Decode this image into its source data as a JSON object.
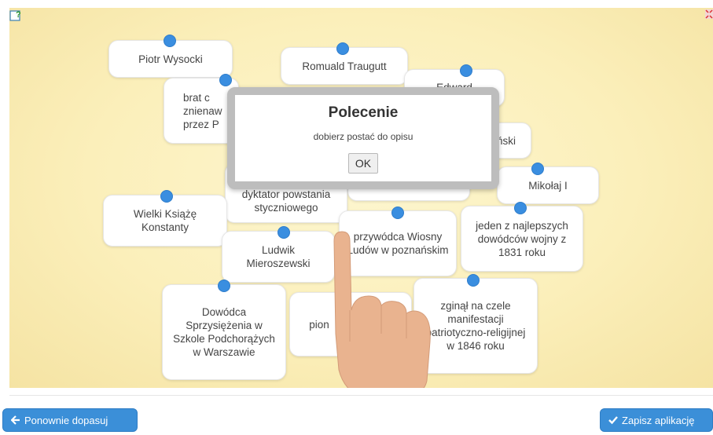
{
  "toolbar": {
    "help_icon": "help-question-icon",
    "fullscreen_icon": "fullscreen-icon"
  },
  "cards": {
    "piotr_wysocki": "Piotr Wysocki",
    "romuald_traugutt": "Romuald Traugutt",
    "edward": "Edward",
    "brat_partial": "brat c znienaw przez P",
    "ski_partial": "ński",
    "mikolaj": "Mikołaj I",
    "dyktator": "dyktator powstania styczniowego",
    "wielki_ksiaze": "Wielki Książę Konstanty",
    "wiosna_ludow": "przywódca Wiosny Ludów w poznańskim",
    "jeden_z": "jeden z najlepszych dowódców wojny z 1831 roku",
    "ludwik": "Ludwik Mieroszewski",
    "dowodca": "Dowódca Sprzysiężenia w Szkole Podchorążych w Warszawie",
    "pion_partial": "pion",
    "zginal": "zginął na czele manifestacji patriotyczno-religijnej w 1846 roku"
  },
  "dialog": {
    "title": "Polecenie",
    "message": "dobierz postać do opisu",
    "ok_label": "OK"
  },
  "footer": {
    "reset_label": "Ponownie dopasuj",
    "save_label": "Zapisz aplikację"
  },
  "colors": {
    "accent": "#3b8fd8",
    "dot": "#3a8ee0",
    "background": "#fbefba"
  }
}
